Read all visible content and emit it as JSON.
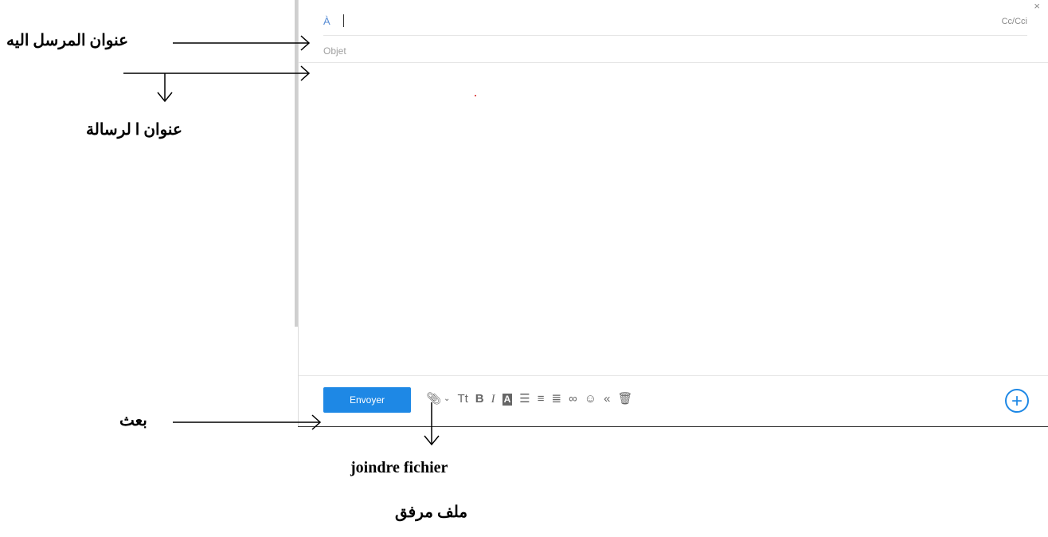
{
  "compose": {
    "to_label": "À",
    "cc_label": "Cc/Cci",
    "close_symbol": "×",
    "subject_placeholder": "Objet",
    "send_label": "Envoyer",
    "toolbar_icons": [
      "attach-icon",
      "chevron-down-icon",
      "font-size-icon",
      "bold-icon",
      "italic-icon",
      "text-color-icon",
      "bullet-list-icon",
      "indent-icon",
      "align-icon",
      "link-icon",
      "emoji-icon",
      "quote-icon",
      "trash-icon"
    ],
    "plus_symbol": "+"
  },
  "annotations": {
    "recipient": "عنوان المرسل اليه",
    "subject": "عنوان ا لرسالة",
    "send": "بعث",
    "attach_fr": "joindre fichier",
    "attach_ar": "ملف مرفق"
  },
  "colors": {
    "accent": "#1e88e5",
    "to_label": "#5b8fd6"
  }
}
